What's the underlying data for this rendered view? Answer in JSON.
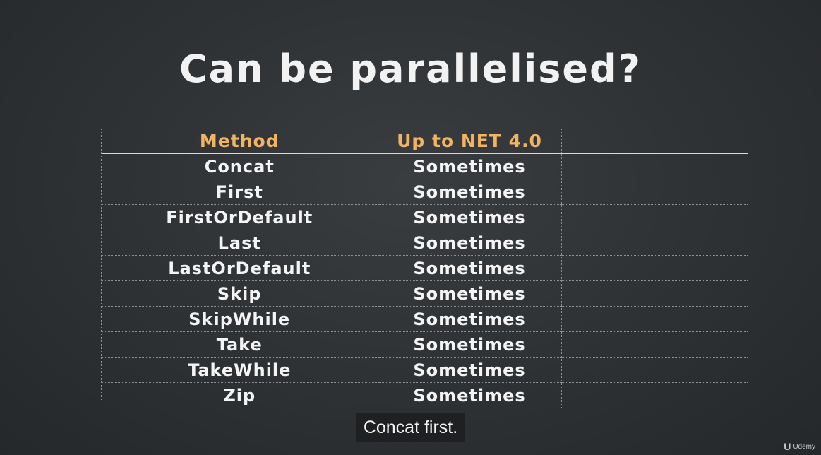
{
  "slide": {
    "title": "Can be parallelised?",
    "table": {
      "headers": [
        "Method",
        "Up to NET 4.0",
        ""
      ],
      "rows": [
        [
          "Concat",
          "Sometimes",
          ""
        ],
        [
          "First",
          "Sometimes",
          ""
        ],
        [
          "FirstOrDefault",
          "Sometimes",
          ""
        ],
        [
          "Last",
          "Sometimes",
          ""
        ],
        [
          "LastOrDefault",
          "Sometimes",
          ""
        ],
        [
          "Skip",
          "Sometimes",
          ""
        ],
        [
          "SkipWhile",
          "Sometimes",
          ""
        ],
        [
          "Take",
          "Sometimes",
          ""
        ],
        [
          "TakeWhile",
          "Sometimes",
          ""
        ],
        [
          "Zip",
          "Sometimes",
          ""
        ]
      ]
    }
  },
  "subtitle": "Concat first.",
  "brand": {
    "logo": "U",
    "name": "Udemy"
  },
  "colors": {
    "background": "#2b2e31",
    "header_text": "#f0b463",
    "text": "#f4f4f4"
  }
}
